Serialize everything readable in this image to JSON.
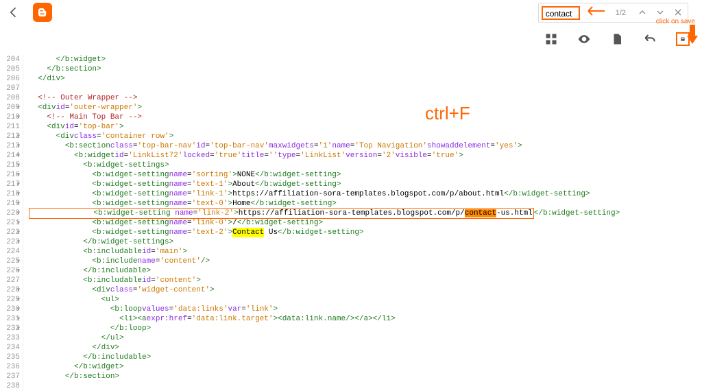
{
  "search": {
    "value": "contact",
    "count": "1/2"
  },
  "annot": {
    "clickSave": "click on save",
    "ctrlF": "ctrl+F"
  },
  "gutter": [
    "204",
    "205",
    "206",
    "207",
    "208",
    "209",
    "210",
    "211",
    "212",
    "213",
    "214",
    "215",
    "216",
    "217",
    "218",
    "219",
    "220",
    "221",
    "222",
    "223",
    "224",
    "225",
    "226",
    "227",
    "228",
    "229",
    "230",
    "231",
    "232",
    "233",
    "234",
    "235",
    "236",
    "237",
    "238"
  ],
  "code": {
    "l204": {
      "ind": 6,
      "tag": "</b:widget>"
    },
    "l205": {
      "ind": 4,
      "tag": "</b:section>"
    },
    "l206": {
      "ind": 2,
      "tag": "</div>"
    },
    "l207": {
      "ind": 0,
      "tag": ""
    },
    "l208": {
      "ind": 2,
      "cmt": "<!-- Outer Wrapper -->"
    },
    "l209": {
      "ind": 2,
      "open": "<div",
      "a1": "id",
      "v1": "outer-wrapper",
      "close": ">"
    },
    "l210": {
      "ind": 4,
      "cmt": "<!-- Main Top Bar -->"
    },
    "l211": {
      "ind": 4,
      "open": "<div",
      "a1": "id",
      "v1": "top-bar",
      "close": ">"
    },
    "l212": {
      "ind": 6,
      "open": "<div",
      "a1": "class",
      "v1": "container row",
      "close": ">"
    },
    "l213": {
      "ind": 8,
      "open": "<b:section",
      "a1": "class",
      "v1": "top-bar-nav",
      "a2": "id",
      "v2": "top-bar-nav",
      "a3": "maxwidgets",
      "v3": "1",
      "a4": "name",
      "v4": "Top Navigation",
      "a5": "showaddelement",
      "v5": "yes",
      "close": ">"
    },
    "l214": {
      "ind": 10,
      "open": "<b:widget",
      "a1": "id",
      "v1": "LinkList72",
      "a2": "locked",
      "v2": "true",
      "a3": "title",
      "v3": "",
      "a4": "type",
      "v4": "LinkList",
      "a5": "version",
      "v5": "2",
      "a6": "visible",
      "v6": "true",
      "close": ">"
    },
    "l215": {
      "ind": 12,
      "tag": "<b:widget-settings>"
    },
    "l216": {
      "ind": 14,
      "open": "<b:widget-setting",
      "a1": "name",
      "v1": "sorting",
      "close": ">",
      "txt": "NONE",
      "end": "</b:widget-setting>"
    },
    "l217": {
      "ind": 14,
      "open": "<b:widget-setting",
      "a1": "name",
      "v1": "text-1",
      "close": ">",
      "txt": "About",
      "end": "</b:widget-setting>"
    },
    "l218": {
      "ind": 14,
      "open": "<b:widget-setting",
      "a1": "name",
      "v1": "link-1",
      "close": ">",
      "txt": "https://affiliation-sora-templates.blogspot.com/p/about.html",
      "end": "</b:widget-setting>"
    },
    "l219": {
      "ind": 14,
      "open": "<b:widget-setting",
      "a1": "name",
      "v1": "text-0",
      "close": ">",
      "txt": "Home",
      "end": "</b:widget-setting>"
    },
    "l220": {
      "ind": 14,
      "open": "<b:widget-setting",
      "a1": "name",
      "v1": "link-2",
      "close": ">",
      "pre": "https://affiliation-sora-templates.blogspot.com/p/",
      "hl": "contact",
      "post": "-us.html",
      "end": "</b:widget-setting>"
    },
    "l221": {
      "ind": 14,
      "open": "<b:widget-setting",
      "a1": "name",
      "v1": "link-0",
      "close": ">",
      "txt": "/",
      "end": "</b:widget-setting>"
    },
    "l222": {
      "ind": 14,
      "open": "<b:widget-setting",
      "a1": "name",
      "v1": "text-2",
      "close": ">",
      "hl": "Contact",
      "post": " Us",
      "end": "</b:widget-setting>"
    },
    "l223": {
      "ind": 12,
      "tag": "</b:widget-settings>"
    },
    "l224": {
      "ind": 12,
      "open": "<b:includable",
      "a1": "id",
      "v1": "main",
      "close": ">"
    },
    "l225": {
      "ind": 14,
      "open": "<b:include",
      "a1": "name",
      "v1": "content",
      "close": "/>"
    },
    "l226": {
      "ind": 12,
      "tag": "</b:includable>"
    },
    "l227": {
      "ind": 12,
      "open": "<b:includable",
      "a1": "id",
      "v1": "content",
      "close": ">"
    },
    "l228": {
      "ind": 14,
      "open": "<div",
      "a1": "class",
      "v1": "widget-content",
      "close": ">"
    },
    "l229": {
      "ind": 16,
      "tag": "<ul>"
    },
    "l230": {
      "ind": 18,
      "open": "<b:loop",
      "a1": "values",
      "v1": "data:links",
      "a2": "var",
      "v2": "link",
      "close": ">"
    },
    "l231": {
      "ind": 20,
      "raw": "<li><a expr:href='data:link.target'><data:link.name/></a></li>"
    },
    "l232": {
      "ind": 18,
      "tag": "</b:loop>"
    },
    "l233": {
      "ind": 16,
      "tag": "</ul>"
    },
    "l234": {
      "ind": 14,
      "tag": "</div>"
    },
    "l235": {
      "ind": 12,
      "tag": "</b:includable>"
    },
    "l236": {
      "ind": 10,
      "tag": "</b:widget>"
    },
    "l237": {
      "ind": 8,
      "tag": "</b:section>"
    },
    "l238": {
      "ind": 0,
      "tag": ""
    }
  }
}
